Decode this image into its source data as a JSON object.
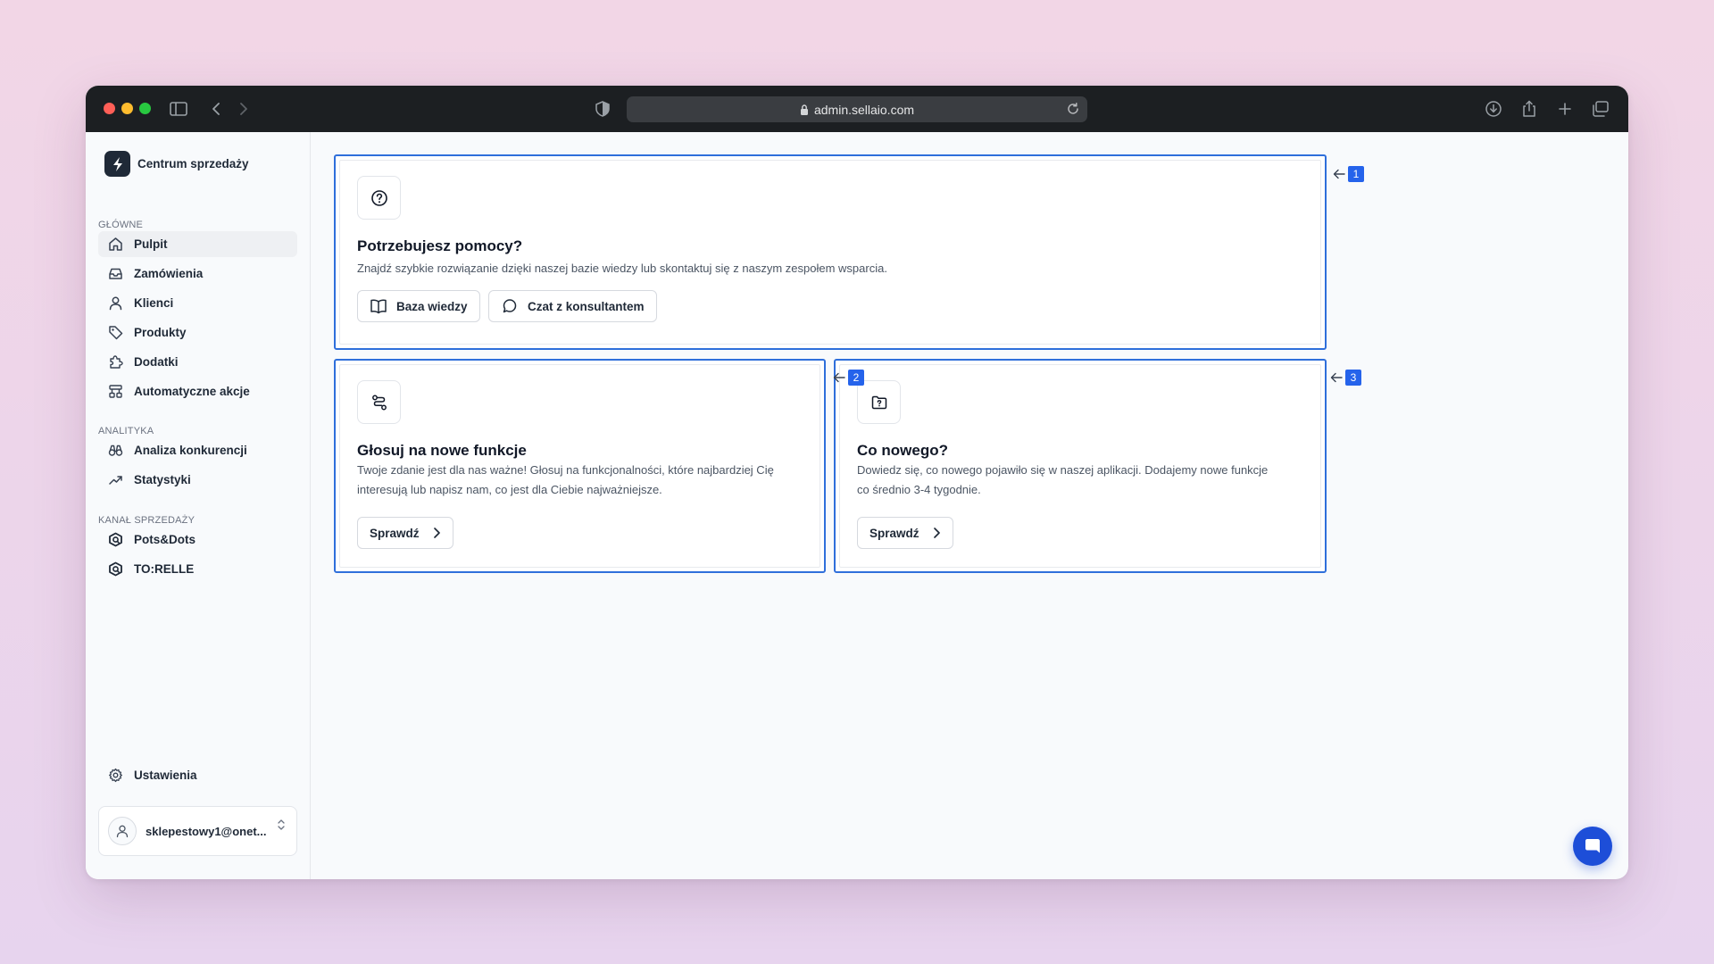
{
  "browser": {
    "url": "admin.sellaio.com"
  },
  "sidebar": {
    "brand": "Centrum sprzedaży",
    "sections": [
      {
        "label": "GŁÓWNE",
        "items": [
          {
            "label": "Pulpit",
            "icon": "home-icon",
            "active": true
          },
          {
            "label": "Zamówienia",
            "icon": "inbox-icon"
          },
          {
            "label": "Klienci",
            "icon": "user-icon"
          },
          {
            "label": "Produkty",
            "icon": "tag-icon"
          },
          {
            "label": "Dodatki",
            "icon": "puzzle-icon"
          },
          {
            "label": "Automatyczne akcje",
            "icon": "workflow-icon"
          }
        ]
      },
      {
        "label": "ANALITYKA",
        "items": [
          {
            "label": "Analiza konkurencji",
            "icon": "binoculars-icon"
          },
          {
            "label": "Statystyki",
            "icon": "trending-up-icon"
          }
        ]
      },
      {
        "label": "KANAŁ SPRZEDAŻY",
        "items": [
          {
            "label": "Pots&Dots",
            "icon": "store-hexagon-icon"
          },
          {
            "label": "TO:RELLE",
            "icon": "store-hexagon-icon"
          }
        ]
      }
    ],
    "settings": "Ustawienia",
    "user_email": "sklepestowy1@onet..."
  },
  "cards": {
    "help": {
      "title": "Potrzebujesz pomocy?",
      "description": "Znajdź szybkie rozwiązanie dzięki naszej bazie wiedzy lub skontaktuj się z naszym zespołem wsparcia.",
      "btn_knowledge": "Baza wiedzy",
      "btn_chat": "Czat z konsultantem"
    },
    "vote": {
      "title": "Głosuj na nowe funkcje",
      "description_line1": "Twoje zdanie jest dla nas ważne! Głosuj na funkcjonalności, które najbardziej Cię",
      "description_line2": "interesują lub napisz nam, co jest dla Ciebie najważniejsze.",
      "button": "Sprawdź"
    },
    "news": {
      "title": "Co nowego?",
      "description_line1": "Dowiedz się, co nowego pojawiło się w naszej aplikacji. Dodajemy nowe funkcje",
      "description_line2": "co średnio 3-4 tygodnie.",
      "button": "Sprawdź"
    }
  },
  "markers": [
    "1",
    "2",
    "3"
  ],
  "colors": {
    "accent": "#2f6fdb",
    "badge": "#2563eb",
    "chat_fab": "#1d4ed8"
  }
}
